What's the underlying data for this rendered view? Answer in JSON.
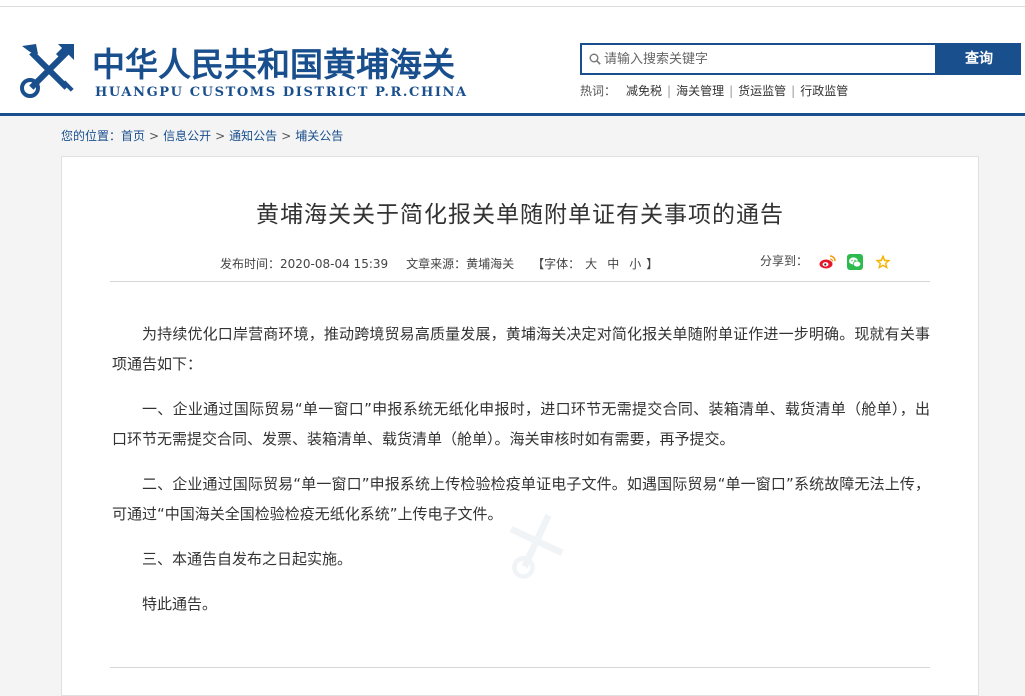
{
  "header": {
    "site_title": "中华人民共和国黄埔海关",
    "site_subtitle": "HUANGPU CUSTOMS DISTRICT P.R.CHINA",
    "brand_color": "#1a4f8e",
    "logo_icon": "customs-emblem-icon"
  },
  "search": {
    "placeholder": "请输入搜索关键字",
    "button_label": "查询",
    "icon": "search-icon"
  },
  "hot_words": {
    "label": "热词：",
    "items": [
      "减免税",
      "海关管理",
      "货运监管",
      "行政监管"
    ]
  },
  "breadcrumb": {
    "prefix": "您的位置：",
    "items": [
      "首页",
      "信息公开",
      "通知公告",
      "埔关公告"
    ],
    "separator": ">"
  },
  "article": {
    "title": "黄埔海关关于简化报关单随附单证有关事项的通告",
    "publish_label": "发布时间：2020-08-04 15:39",
    "source_label": "文章来源：黄埔海关",
    "font_prefix": "【字体：",
    "font_large": "大",
    "font_medium": "中",
    "font_small": "小",
    "font_suffix": "】",
    "share_label": "分享到：",
    "share_icons": [
      "weibo-icon",
      "wechat-icon",
      "favorite-star-icon"
    ],
    "paragraphs": [
      "为持续优化口岸营商环境，推动跨境贸易高质量发展，黄埔海关决定对简化报关单随附单证作进一步明确。现就有关事项通告如下：",
      "一、企业通过国际贸易“单一窗口”申报系统无纸化申报时，进口环节无需提交合同、装箱清单、载货清单（舱单），出口环节无需提交合同、发票、装箱清单、载货清单（舱单）。海关审核时如有需要，再予提交。",
      "二、企业通过国际贸易“单一窗口”申报系统上传检验检疫单证电子文件。如遇国际贸易“单一窗口”系统故障无法上传，可通过“中国海关全国检验检疫无纸化系统”上传电子文件。",
      "三、本通告自发布之日起实施。",
      "特此通告。"
    ]
  }
}
